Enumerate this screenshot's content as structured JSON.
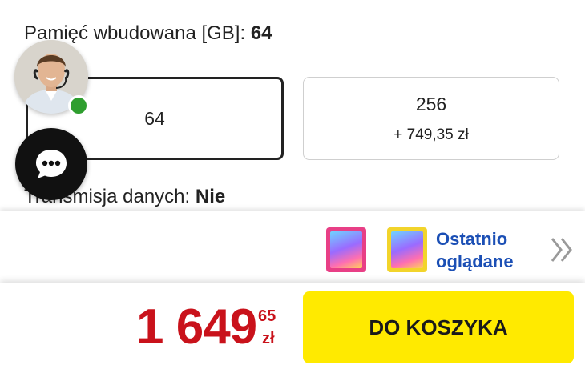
{
  "memory": {
    "label": "Pamięć wbudowana [GB]:",
    "value": "64",
    "options": [
      {
        "label": "64",
        "price_diff": "",
        "selected": true
      },
      {
        "label": "256",
        "price_diff": "+ 749,35 zł",
        "selected": false
      }
    ]
  },
  "transmission": {
    "label": "Transmisja danych:",
    "value": "Nie"
  },
  "chat": {
    "avatar_icon": "consultant-avatar",
    "status_icon": "online-status-dot",
    "chat_icon": "chat-bubble-icon"
  },
  "recent": {
    "label_line1": "Ostatnio",
    "label_line2": "oglądane",
    "items": [
      {
        "icon": "tablet-thumbnail-pink",
        "color": "#e83f86"
      },
      {
        "icon": "tablet-thumbnail-yellow",
        "color": "#f2d42b"
      }
    ],
    "more_icon": "double-chevron-right-icon"
  },
  "price": {
    "main": "1 649",
    "cents": "65",
    "currency": "zł",
    "color": "#c9121b"
  },
  "cart_button": {
    "label": "DO KOSZYKA",
    "color": "#ffea00"
  }
}
